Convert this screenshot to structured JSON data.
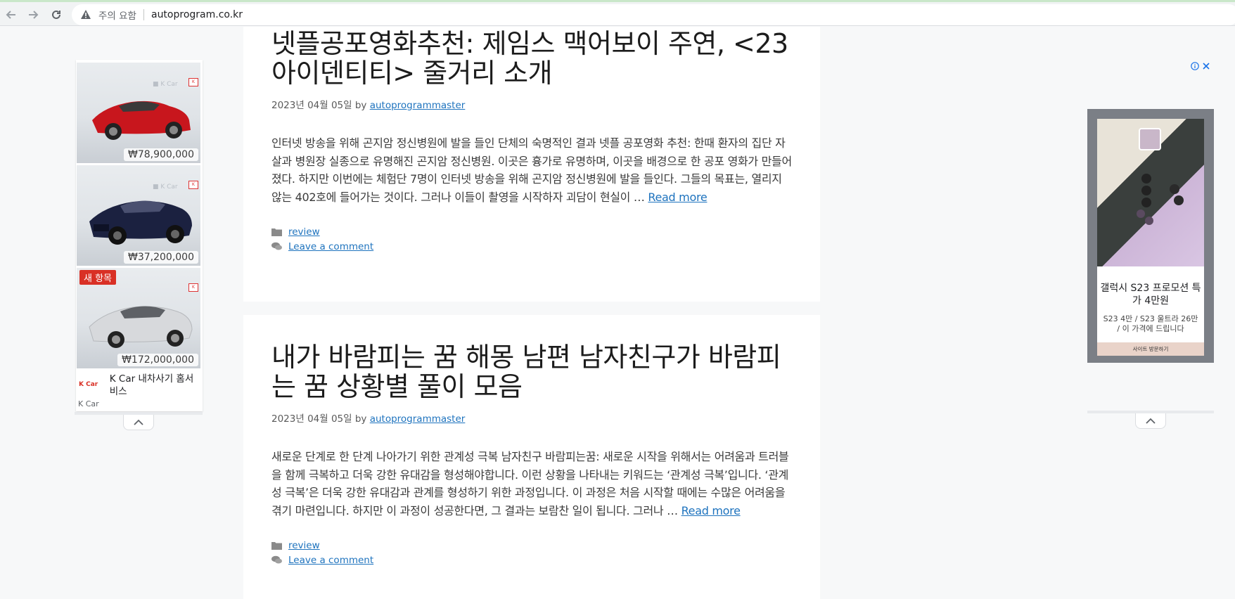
{
  "browser": {
    "security_warning": "주의 요함",
    "url": "autoprogram.co.kr"
  },
  "posts": [
    {
      "title": "넷플공포영화추천: 제임스 맥어보이 주연, <23 아이덴티티> 줄거리 소개",
      "date": "2023년 04월 05일",
      "by": "by",
      "author": "autoprogrammaster",
      "excerpt": "인터넷 방송을 위해 곤지암 정신병원에 발을 들인 단체의 숙명적인 결과 넷플 공포영화 추천: 한때 환자의 집단 자살과 병원장 실종으로 유명해진 곤지암 정신병원. 이곳은 흉가로 유명하며, 이곳을 배경으로 한 공포 영화가 만들어졌다. 하지만 이번에는 체험단 7명이 인터넷 방송을 위해 곤지암 정신병원에 발을 들인다. 그들의 목표는, 열리지 않는 402호에 들어가는 것이다. 그러나 이들이 촬영을 시작하자 괴담이 현실이 …",
      "read_more": "Read more",
      "category": "review",
      "comment": "Leave a comment"
    },
    {
      "title": "내가 바람피는 꿈 해몽 남편 남자친구가 바람피는 꿈 상황별 풀이 모음",
      "date": "2023년 04월 05일",
      "by": "by",
      "author": "autoprogrammaster",
      "excerpt": "새로운 단계로 한 단계 나아가기 위한 관계성 극복 남자친구 바람피는꿈: 새로운 시작을 위해서는 어려움과 트러블을 함께 극복하고 더욱 강한 유대감을 형성해야합니다. 이런 상황을 나타내는 키워드는 ‘관계성 극복’입니다. ‘관계성 극복’은 더욱 강한 유대감과 관계를 형성하기 위한 과정입니다. 이 과정은 처음 시작할 때에는 수많은 어려움을 겪기 마련입니다. 하지만 이 과정이 성공한다면, 그 결과는 보람찬 일이 됩니다. 그러나 …",
      "read_more": "Read more",
      "category": "review",
      "comment": "Leave a comment"
    }
  ],
  "ad_left": {
    "items": [
      {
        "price": "₩78,900,000",
        "color": "#c8161d"
      },
      {
        "price": "₩37,200,000",
        "color": "#1b2140"
      },
      {
        "price": "₩172,000,000",
        "color": "#d7d9dc"
      }
    ],
    "new_badge": "새 항목",
    "logo_text": "K Car",
    "advertiser": "K Car 내차사기 홈서비스",
    "advertiser_small": "K Car"
  },
  "ad_right": {
    "title": "갤럭시 S23 프로모션 특가 4만원",
    "subtitle": "S23 4만 / S23 울트라 26만 / 이 가격에 드립니다",
    "cta": "사이트 방문하기"
  },
  "icons": {
    "back": "arrow-left-icon",
    "forward": "arrow-right-icon",
    "reload": "reload-icon",
    "warning": "warning-triangle-icon",
    "folder": "folder-icon",
    "comment": "comments-icon",
    "adchoices": "info-icon",
    "close": "close-icon",
    "collapse": "chevron-up-icon"
  },
  "colors": {
    "link": "#1e73be",
    "badge": "#d93025"
  }
}
